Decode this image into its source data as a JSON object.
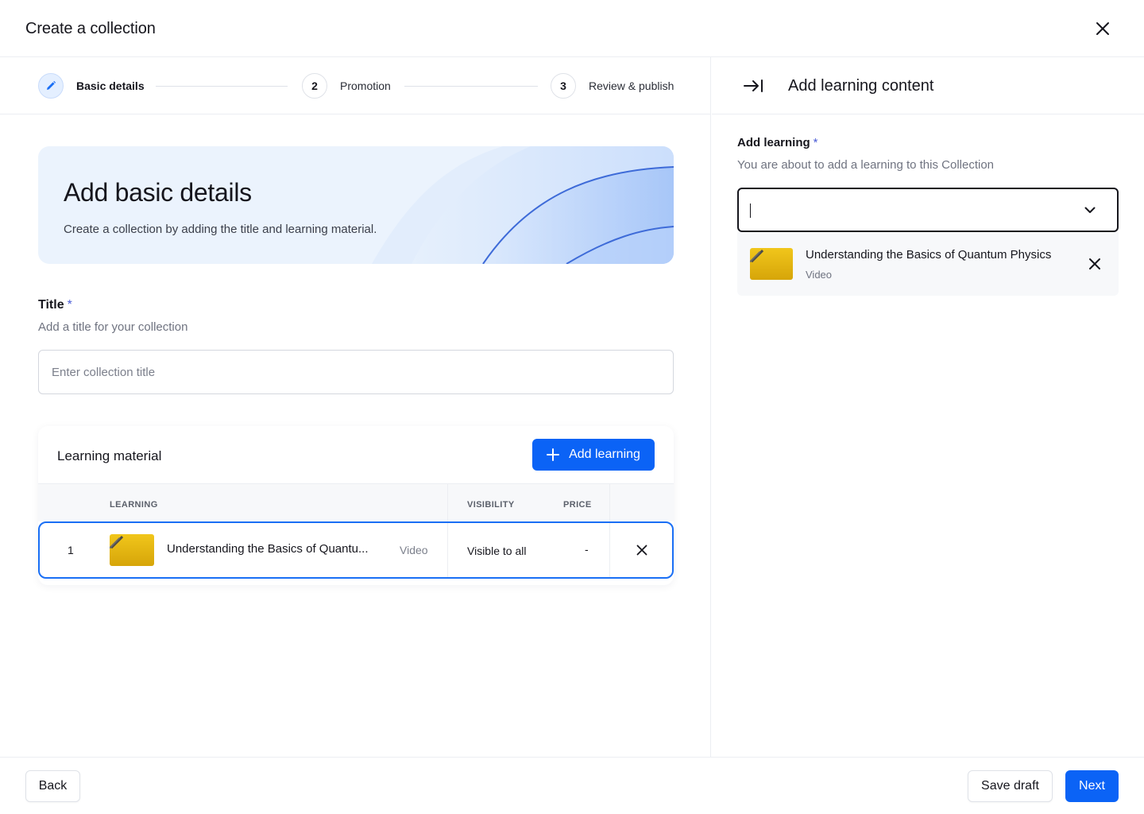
{
  "header": {
    "title": "Create a collection"
  },
  "stepper": {
    "steps": [
      {
        "number": "",
        "label": "Basic details",
        "state": "active"
      },
      {
        "number": "2",
        "label": "Promotion",
        "state": "pending"
      },
      {
        "number": "3",
        "label": "Review & publish",
        "state": "pending"
      }
    ]
  },
  "hero": {
    "title": "Add basic details",
    "subtitle": "Create a collection by adding the title and learning material."
  },
  "title_field": {
    "label": "Title",
    "required_mark": "*",
    "help": "Add a title for your collection",
    "value": "",
    "placeholder": "Enter collection title"
  },
  "learning_material": {
    "title": "Learning material",
    "add_button_label": "Add learning",
    "columns": {
      "learning": "LEARNING",
      "visibility": "VISIBILITY",
      "price": "PRICE"
    },
    "rows": [
      {
        "index": "1",
        "name": "Understanding the Basics of Quantu...",
        "type": "Video",
        "visibility": "Visible to all",
        "price": "-"
      }
    ]
  },
  "side_panel": {
    "title": "Add learning content",
    "field_label": "Add learning",
    "required_mark": "*",
    "help": "You are about to add a learning to this Collection",
    "search_value": "",
    "selected_items": [
      {
        "name": "Understanding the Basics of Quantum Physics",
        "type": "Video"
      }
    ]
  },
  "footer": {
    "back_label": "Back",
    "save_draft_label": "Save draft",
    "next_label": "Next"
  },
  "colors": {
    "primary": "#0b63f6",
    "selected_border": "#1a6ff5",
    "required": "#4a5cd6",
    "thumbnail": "#f1c61b"
  },
  "icons": {
    "close": "close-icon",
    "step_active": "pencil-icon",
    "add": "plus-icon",
    "collapse": "collapse-right-icon",
    "dropdown": "chevron-down-icon",
    "remove": "close-icon"
  }
}
